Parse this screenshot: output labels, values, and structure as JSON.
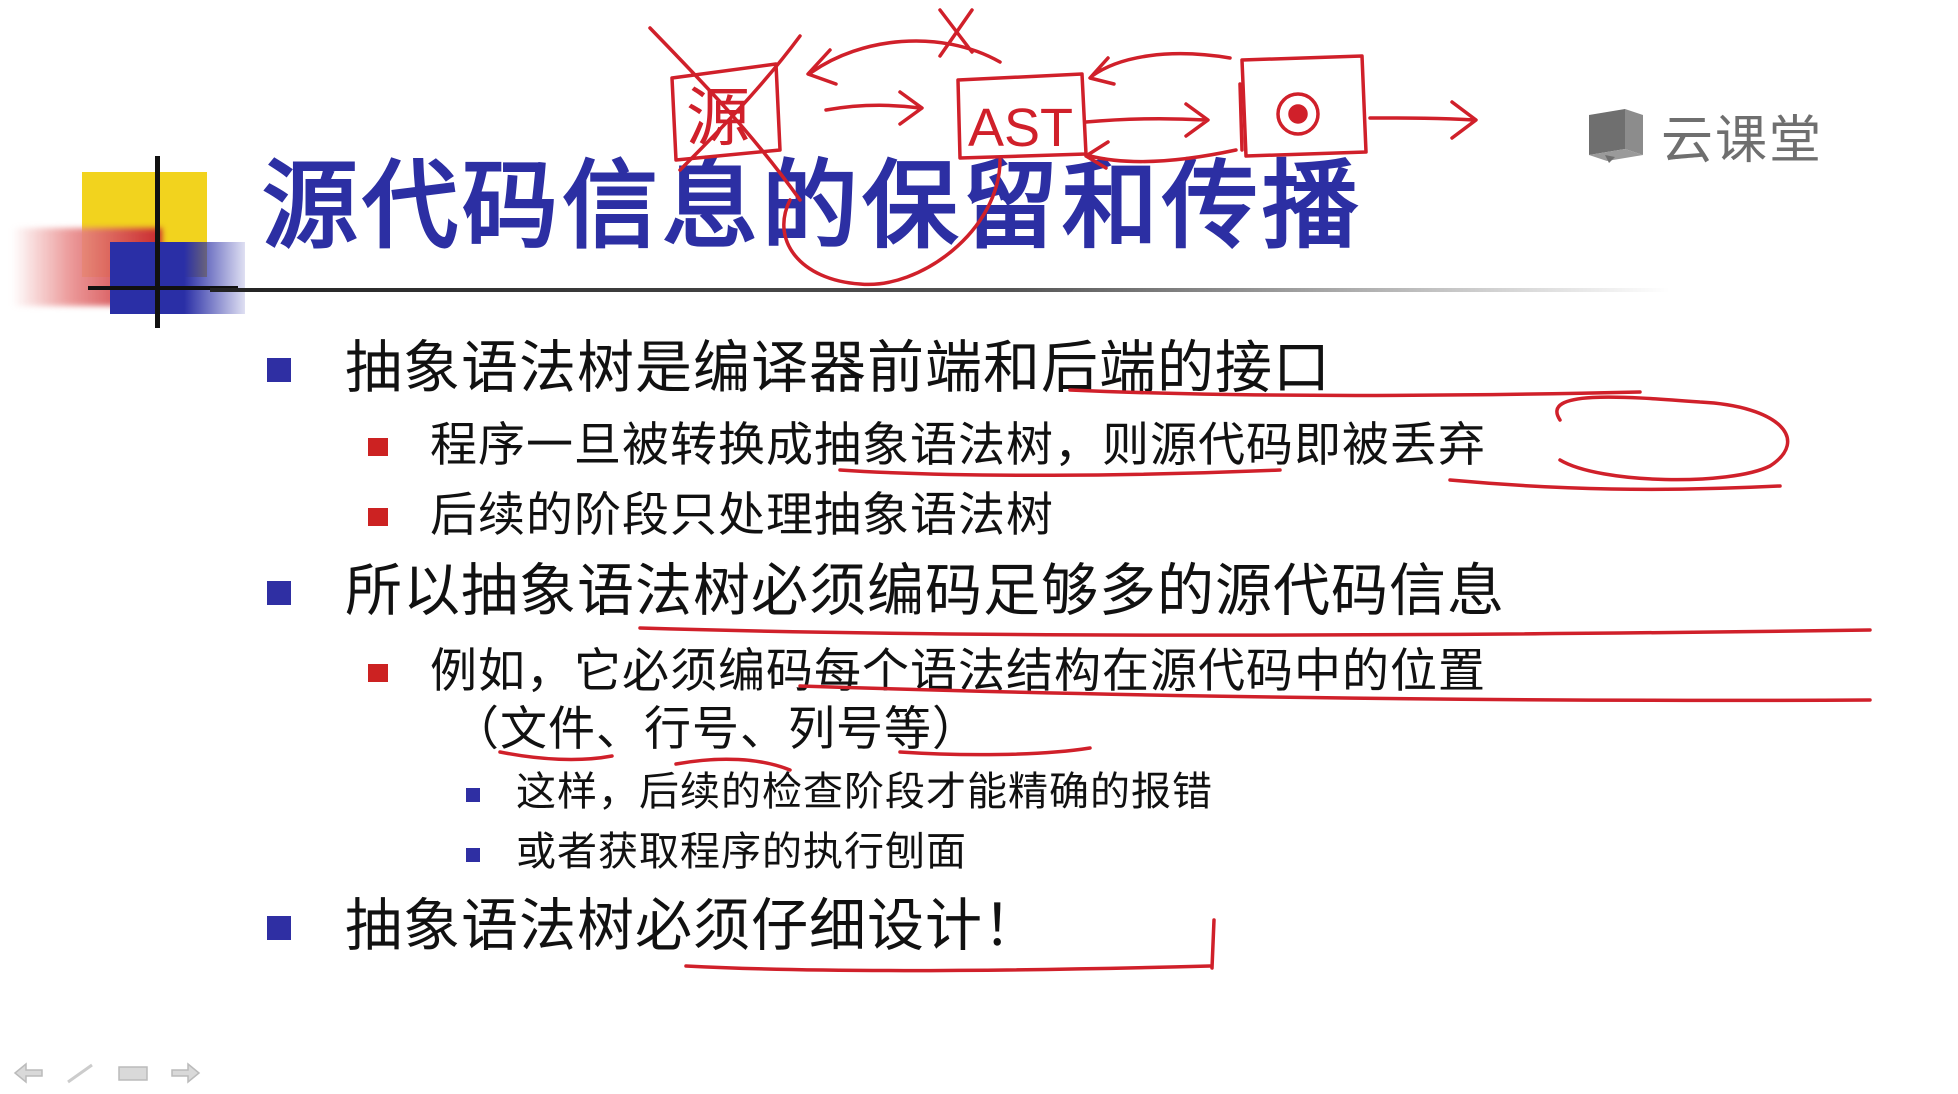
{
  "slide": {
    "title": "源代码信息的保留和传播",
    "bullets": [
      {
        "level": 1,
        "text": "抽象语法树是编译器前端和后端的接口"
      },
      {
        "level": 2,
        "text": "程序一旦被转换成抽象语法树，则源代码即被丢弃"
      },
      {
        "level": 2,
        "text": "后续的阶段只处理抽象语法树"
      },
      {
        "level": 1,
        "text": "所以抽象语法树必须编码足够多的源代码信息"
      },
      {
        "level": 2,
        "text": "例如，它必须编码每个语法结构在源代码中的位置"
      },
      {
        "level": 2,
        "text": "（文件、行号、列号等）"
      },
      {
        "level": 3,
        "text": "这样，后续的检查阶段才能精确的报错"
      },
      {
        "level": 3,
        "text": "或者获取程序的执行刨面"
      },
      {
        "level": 1,
        "text": "抽象语法树必须仔细设计！"
      }
    ]
  },
  "watermark": {
    "brand": "云课堂",
    "icon": "cloud-classroom-logo-icon"
  },
  "annotations": {
    "box_source": "源",
    "box_ast": "AST"
  },
  "toolbar": {
    "prev_icon": "arrow-left-icon",
    "pen_icon": "pen-icon",
    "menu_icon": "slide-menu-icon",
    "next_icon": "arrow-right-icon"
  },
  "colors": {
    "title": "#2c2fa3",
    "bullet_l1": "#2f2fa3",
    "bullet_l2": "#cc2222",
    "ink": "#d0202a"
  }
}
